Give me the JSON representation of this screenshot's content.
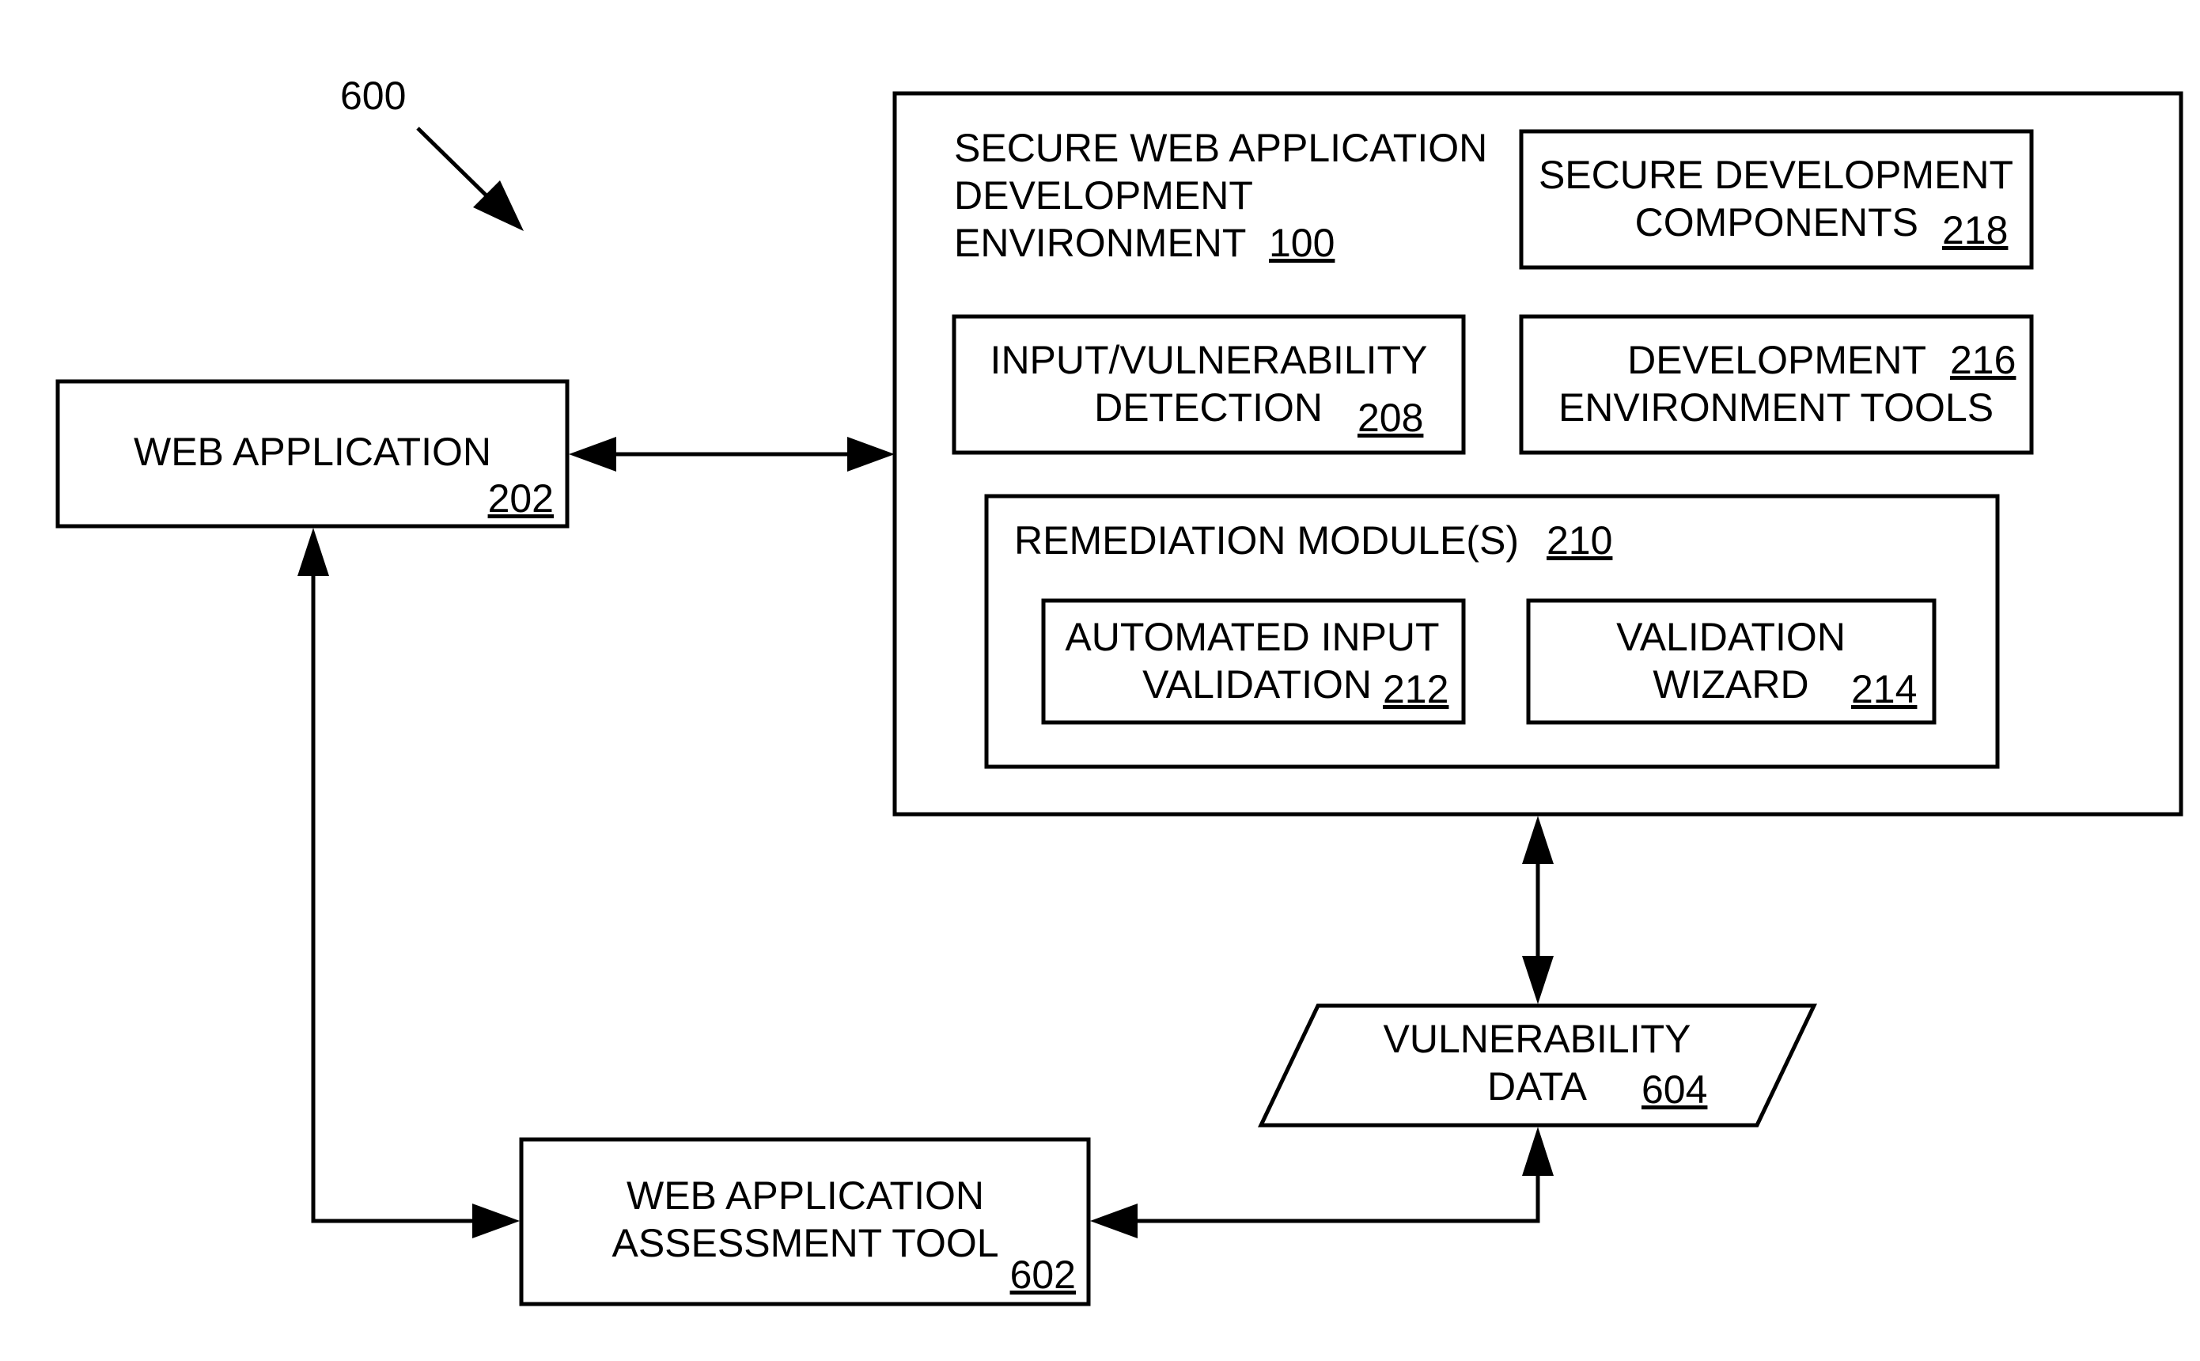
{
  "figure": {
    "label": "600",
    "colors": {
      "stroke": "#000000",
      "background": "#ffffff"
    }
  },
  "environment": {
    "title_lines": [
      "SECURE WEB APPLICATION",
      "DEVELOPMENT",
      "ENVIRONMENT"
    ],
    "ref": "100",
    "components": {
      "secure_components": {
        "lines": [
          "SECURE DEVELOPMENT",
          "COMPONENTS"
        ],
        "ref": "218"
      },
      "detection": {
        "lines": [
          "INPUT/VULNERABILITY",
          "DETECTION"
        ],
        "ref": "208"
      },
      "dev_tools": {
        "lines": [
          "DEVELOPMENT",
          "ENVIRONMENT TOOLS"
        ],
        "ref": "216"
      },
      "remediation": {
        "label": "REMEDIATION MODULE(S)",
        "ref": "210",
        "automated": {
          "lines": [
            "AUTOMATED INPUT",
            "VALIDATION"
          ],
          "ref": "212"
        },
        "wizard": {
          "lines": [
            "VALIDATION",
            "WIZARD"
          ],
          "ref": "214"
        }
      }
    }
  },
  "web_application": {
    "label": "WEB APPLICATION",
    "ref": "202"
  },
  "assessment_tool": {
    "lines": [
      "WEB APPLICATION",
      "ASSESSMENT TOOL"
    ],
    "ref": "602"
  },
  "vulnerability_data": {
    "lines": [
      "VULNERABILITY",
      "DATA"
    ],
    "ref": "604"
  }
}
